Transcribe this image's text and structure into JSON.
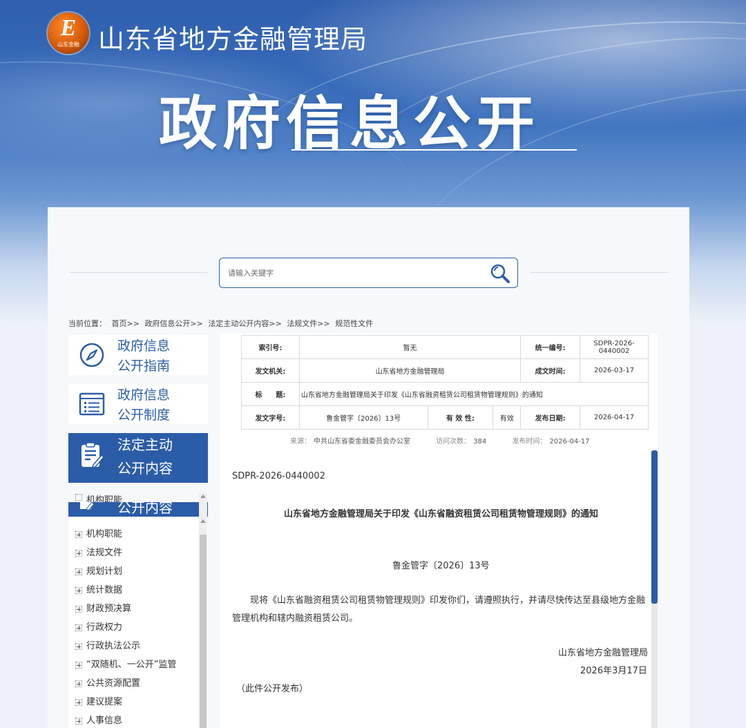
{
  "header": {
    "logo_caption": "山东金融",
    "logo_letter": "E",
    "site_name": "山东省地方金融管理局",
    "hero_title": "政府信息公开"
  },
  "search": {
    "placeholder": "请输入关键字",
    "icon": "search-icon"
  },
  "breadcrumb": {
    "prefix": "当前位置：",
    "items": [
      "首页>>",
      "政府信息公开>>",
      "法定主动公开内容>>",
      "法规文件>>",
      "规范性文件"
    ]
  },
  "sidebar": {
    "cards": [
      {
        "line1": "政府信息",
        "line2": "公开指南",
        "icon": "compass-icon"
      },
      {
        "line1": "政府信息",
        "line2": "公开制度",
        "icon": "list-icon"
      },
      {
        "line1": "法定主动",
        "line2": "公开内容",
        "icon": "clipboard-icon",
        "active": true
      }
    ],
    "ghost_label": "公开内容",
    "ghost_top_text": "机构职能",
    "tree": [
      "机构职能",
      "法规文件",
      "规划计划",
      "统计数据",
      "财政预决算",
      "行政权力",
      "行政执法公示",
      "“双随机、一公开”监管",
      "公共资源配置",
      "建议提案",
      "人事信息"
    ]
  },
  "meta": {
    "index_label": "索引号:",
    "index_value": "暂无",
    "unified_label": "统一编号:",
    "unified_value": "SDPR-2026-0440002",
    "issuer_label": "发文机关:",
    "issuer_value": "山东省地方金融管理局",
    "date_label": "成文时间:",
    "date_value": "2026-03-17",
    "title_label": "标　　题:",
    "title_value": "山东省地方金融管理局关于印发《山东省融资租赁公司租赁物管理规则》的通知",
    "docno_label": "发文字号:",
    "docno_value": "鲁金管字〔2026〕13号",
    "validity_label": "有 效 性:",
    "validity_value": "有效",
    "pub_label": "发布日期:",
    "pub_value": "2026-04-17"
  },
  "source": {
    "source_label": "来源：",
    "source_value": "中共山东省委金融委员会办公室",
    "visits_label": "访问次数：",
    "visits_value": "384",
    "pubtime_label": "发布时间：",
    "pubtime_value": "2026-04-17"
  },
  "document": {
    "code": "SDPR-2026-0440002",
    "title": "山东省地方金融管理局关于印发《山东省融资租赁公司租赁物管理规则》的通知",
    "number": "鲁金管字〔2026〕13号",
    "body": "现将《山东省融资租赁公司租赁物管理规则》印发你们，请遵照执行，并请尽快传达至县级地方金融管理机构和辖内融资租赁公司。",
    "signature": "山东省地方金融管理局",
    "date": "2026年3月17日",
    "note": "（此件公开发布）"
  },
  "colors": {
    "accent": "#2b5ca8",
    "logo_orange": "#d45a07"
  }
}
